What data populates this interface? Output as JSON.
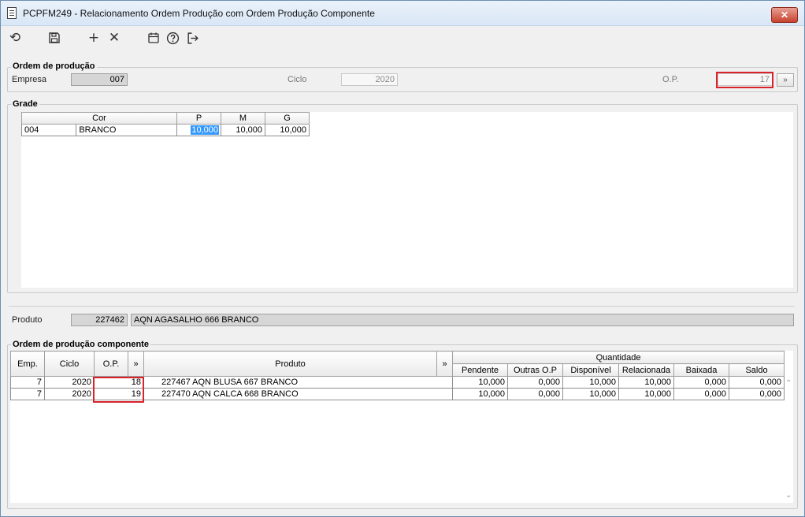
{
  "window": {
    "title": "PCPFM249 - Relacionamento Ordem Produção com Ordem Produção Componente",
    "close_glyph": "✕"
  },
  "toolbar": {
    "icons": [
      "undo-icon",
      "save-icon",
      "add-icon",
      "delete-icon",
      "calendar-icon",
      "help-icon",
      "exit-icon"
    ]
  },
  "ordem": {
    "legend": "Ordem de produção",
    "empresa_label": "Empresa",
    "empresa_value": "007",
    "ciclo_label": "Ciclo",
    "ciclo_value": "2020",
    "op_label": "O.P.",
    "op_value": "17",
    "lookup_glyph": "»"
  },
  "grade": {
    "legend": "Grade",
    "headers": [
      "Cor",
      "P",
      "M",
      "G"
    ],
    "rows": [
      {
        "cod": "004",
        "cor": "BRANCO",
        "p": "10,000",
        "m": "10,000",
        "g": "10,000"
      }
    ]
  },
  "produto": {
    "label": "Produto",
    "code": "227462",
    "desc": "AQN AGASALHO 666 BRANCO"
  },
  "componente": {
    "legend": "Ordem de produção componente",
    "headers": {
      "emp": "Emp.",
      "ciclo": "Ciclo",
      "op": "O.P.",
      "expand1": "»",
      "produto": "Produto",
      "expand2": "»",
      "quantidade": "Quantidade",
      "pendente": "Pendente",
      "outras": "Outras O.P",
      "disponivel": "Disponível",
      "relacionada": "Relacionada",
      "baixada": "Baixada",
      "saldo": "Saldo"
    },
    "rows": [
      {
        "emp": "7",
        "ciclo": "2020",
        "op": "18",
        "produto": "227467 AQN BLUSA 667 BRANCO",
        "pendente": "10,000",
        "outras": "0,000",
        "disponivel": "10,000",
        "relacionada": "10,000",
        "baixada": "0,000",
        "saldo": "0,000"
      },
      {
        "emp": "7",
        "ciclo": "2020",
        "op": "19",
        "produto": "227470 AQN CALCA 668 BRANCO",
        "pendente": "10,000",
        "outras": "0,000",
        "disponivel": "10,000",
        "relacionada": "10,000",
        "baixada": "0,000",
        "saldo": "0,000"
      }
    ]
  },
  "colors": {
    "highlight_box": "#d9232a",
    "selection": "#3399ff"
  }
}
